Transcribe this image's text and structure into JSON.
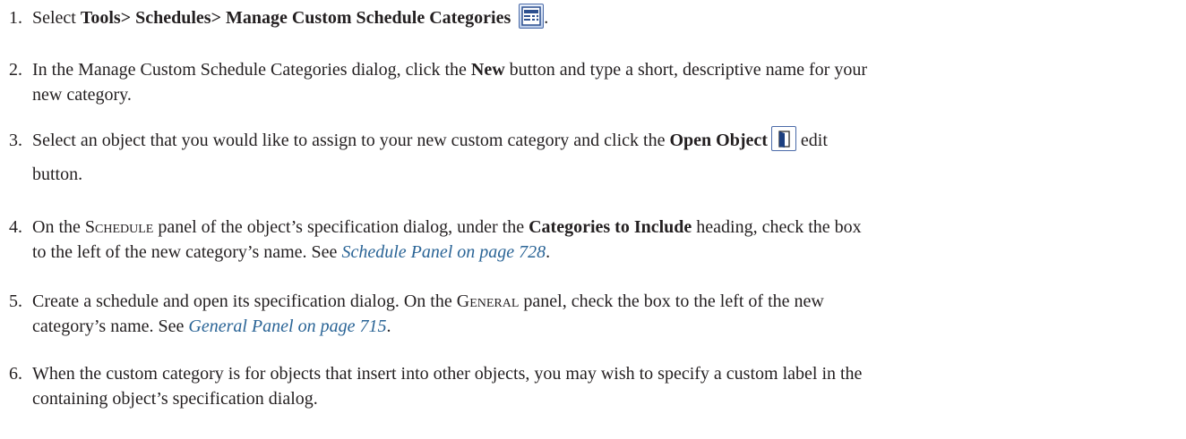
{
  "steps": [
    {
      "number": "1.",
      "select": "Select ",
      "menu_path": "Tools> Schedules> Manage Custom Schedule Categories",
      "icon": "schedule-categories-icon",
      "end": "."
    },
    {
      "number": "2.",
      "line1_pre": "In the Manage Custom Schedule Categories dialog, click the ",
      "new_label": "New",
      "line1_post": " button and type a short, descriptive name for your",
      "line2": "new category."
    },
    {
      "number": "3.",
      "line1_pre": "Select an object that you would like to assign to your new custom category and click the ",
      "open_object_label": "Open Object",
      "icon": "open-object-icon",
      "line1_post": " edit",
      "line2": "button."
    },
    {
      "number": "4.",
      "on_the": "On the ",
      "panel_S": "S",
      "panel_rest": "chedule",
      "line1_mid": " panel of the object’s specification dialog, under the ",
      "heading_label": "Categories to Include",
      "line1_post": " heading, check the box",
      "line2_pre": "to the left of the new category’s name. See ",
      "xref": "Schedule Panel on page 728",
      "line2_post": "."
    },
    {
      "number": "5.",
      "line1_pre": "Create a schedule and open its specification dialog. On the ",
      "panel_G": "G",
      "panel_rest": "eneral",
      "line1_post": " panel, check the box to the left of the new",
      "line2_pre": "category’s name. See ",
      "xref": "General Panel on page 715",
      "line2_post": "."
    },
    {
      "number": "6.",
      "line1": "When the custom category is for objects that insert into other objects, you may wish to specify a custom label in the",
      "line2": "containing object’s specification dialog."
    }
  ]
}
